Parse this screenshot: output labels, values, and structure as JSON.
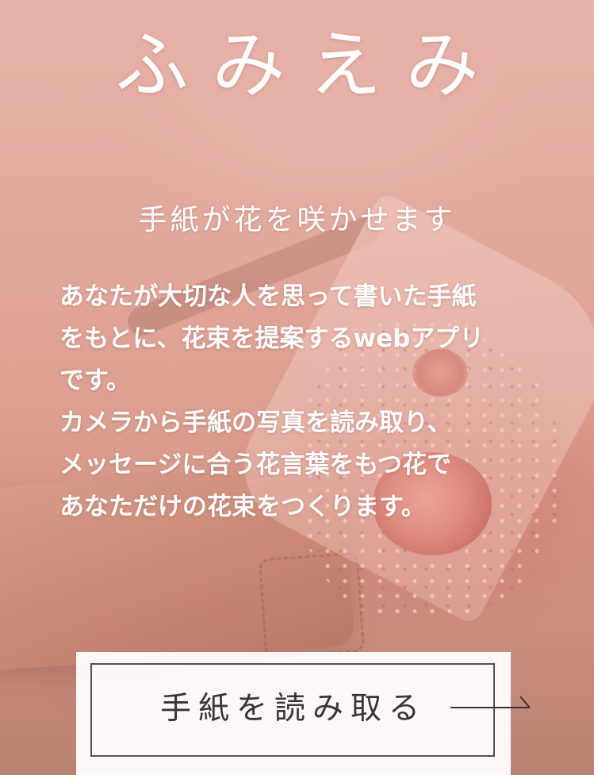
{
  "header": {
    "app_title": "ふみえみ",
    "tagline": "手紙が花を咲かせます"
  },
  "description": {
    "lines": [
      "あなたが大切な人を思って書いた手紙",
      "をもとに、花束を提案するwebアプリ",
      "です。",
      "カメラから手紙の写真を読み取り、",
      "メッセージに合う花言葉をもつ花で",
      "あなただけの花束をつくります。"
    ]
  },
  "action": {
    "read_letter_label": "手紙を読み取る",
    "icon": "arrow-right-icon"
  },
  "colors": {
    "overlay": "#e6aaa0",
    "text_light": "#ffffff",
    "button_bg": "#ffffff",
    "button_text": "#3a3434",
    "button_border": "#555050"
  }
}
